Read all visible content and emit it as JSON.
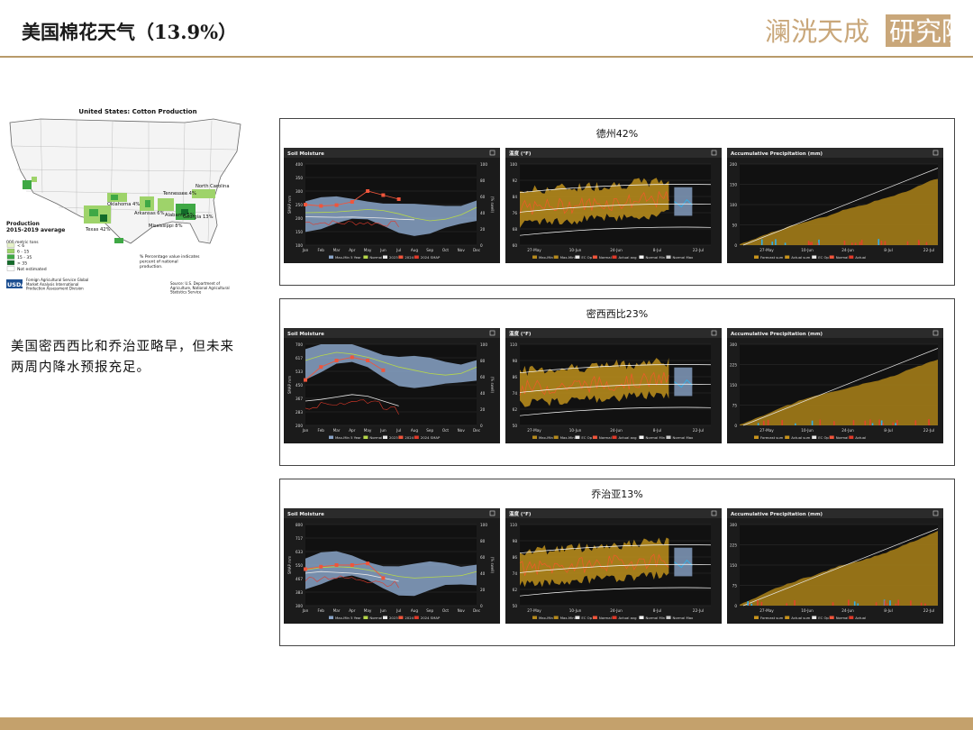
{
  "page": {
    "title": "美国棉花天气（13.9%）",
    "logo_text": "澜洸天成研究院",
    "description": "美国密西西比和乔治亚略早，但未来两周内降水预报充足。"
  },
  "map": {
    "title": "United States: Cotton Production",
    "legend_title": "Production\n2015-2019 average",
    "legend_unit": "000 metric tons",
    "legend_items": [
      "< 6",
      "6 - 15",
      "15 - 35",
      "> 35",
      "Not estimated"
    ],
    "legend_colors": [
      "#e6f2c9",
      "#9ed36a",
      "#3fa845",
      "#136b2a",
      "#ffffff"
    ],
    "labels": [
      "Texas 42%",
      "Oklahoma 4%",
      "Arkansas 6%",
      "Mississippi 8%",
      "Tennessee 4%",
      "Alabama 5%",
      "Georgia 13%",
      "North Carolina"
    ],
    "note": "% Percentage value indicates percent of national production.",
    "usda": "USDA",
    "source_left": "Foreign Agricultural Service Global Market Analysis International Production Assessment Division",
    "source_right": "Source: U.S. Department of Agriculture, National Agricultural Statistics Service"
  },
  "panels": [
    {
      "title": "德州42%"
    },
    {
      "title": "密西西比23%"
    },
    {
      "title": "乔治亚13%"
    }
  ],
  "chart_data": [
    {
      "type": "line",
      "region": "德州42%",
      "title": "Soil Moisture",
      "x": [
        "Jan",
        "Feb",
        "Mar",
        "Apr",
        "May",
        "Jun",
        "Jul",
        "Aug",
        "Sep",
        "Oct",
        "Nov",
        "Dec"
      ],
      "ylabel": "SMAP mm",
      "ylim": [
        100,
        400
      ],
      "y2label": "(% swell)",
      "y2lim": [
        0,
        100
      ],
      "series": [
        {
          "name": "Normal",
          "values": [
            220,
            221,
            223,
            227,
            232,
            228,
            216,
            200,
            190,
            196,
            212,
            240
          ]
        },
        {
          "name": "2023",
          "values": [
            205,
            204,
            203,
            204,
            202,
            200,
            196,
            194,
            null,
            null,
            null,
            null
          ]
        },
        {
          "name": "2024",
          "values": [
            250,
            245,
            248,
            260,
            300,
            285,
            270,
            null,
            null,
            null,
            null,
            null
          ]
        }
      ],
      "legend": [
        "Max-Min 5 Year",
        "Normal",
        "2023",
        "2024",
        "2024 SMAP"
      ]
    },
    {
      "type": "area",
      "region": "德州42%",
      "title": "温度 (°F)",
      "x": [
        "27-May",
        "10-Jun",
        "24-Jun",
        "8-Jul",
        "22-Jul"
      ],
      "ylim": [
        60,
        100
      ],
      "legend": [
        "Max-Min",
        "Max-Min",
        "EC Op",
        "Normal",
        "Actual avg",
        "Normal Min",
        "Normal Max"
      ]
    },
    {
      "type": "area",
      "region": "德州42%",
      "title": "Accumulative Precipitation (mm)",
      "x": [
        "27-May",
        "10-Jun",
        "24-Jun",
        "8-Jul",
        "22-Jul"
      ],
      "ylim": [
        0,
        200
      ],
      "legend": [
        "Forecast sum",
        "Actual sum",
        "EC Op",
        "Normal",
        "Actual"
      ]
    },
    {
      "type": "line",
      "region": "密西西比23%",
      "title": "Soil Moisture",
      "x": [
        "Jan",
        "Feb",
        "Mar",
        "Apr",
        "May",
        "Jun",
        "Jul",
        "Aug",
        "Sep",
        "Oct",
        "Nov",
        "Dec"
      ],
      "ylabel": "SMAP mm",
      "ylim": [
        200,
        700
      ],
      "y2label": "(% swell)",
      "y2lim": [
        0,
        100
      ],
      "series": [
        {
          "name": "Normal",
          "values": [
            600,
            630,
            650,
            640,
            620,
            590,
            560,
            540,
            520,
            510,
            520,
            560
          ]
        },
        {
          "name": "2023",
          "values": [
            350,
            360,
            375,
            390,
            380,
            350,
            320,
            null,
            null,
            null,
            null,
            null
          ]
        },
        {
          "name": "2024",
          "values": [
            480,
            560,
            600,
            620,
            600,
            540,
            null,
            null,
            null,
            null,
            null,
            null
          ]
        }
      ],
      "legend": [
        "Max-Min 5 Year",
        "Normal",
        "2023",
        "2024",
        "2024 SMAP"
      ]
    },
    {
      "type": "area",
      "region": "密西西比23%",
      "title": "温度 (°F)",
      "x": [
        "27-May",
        "10-Jun",
        "24-Jun",
        "8-Jul",
        "22-Jul"
      ],
      "ylim": [
        50,
        110
      ],
      "legend": [
        "Max-Min",
        "Max-Min",
        "EC Op",
        "Normal",
        "Actual avg",
        "Normal Min",
        "Normal Max"
      ]
    },
    {
      "type": "area",
      "region": "密西西比23%",
      "title": "Accumulative Precipitation (mm)",
      "x": [
        "27-May",
        "10-Jun",
        "24-Jun",
        "8-Jul",
        "22-Jul"
      ],
      "ylim": [
        0,
        300
      ],
      "legend": [
        "Forecast sum",
        "Actual sum",
        "EC Op",
        "Normal",
        "Actual"
      ]
    },
    {
      "type": "line",
      "region": "乔治亚13%",
      "title": "Soil Moisture",
      "x": [
        "Jan",
        "Feb",
        "Mar",
        "Apr",
        "May",
        "Jun",
        "Jul",
        "Aug",
        "Sep",
        "Oct",
        "Nov",
        "Dec"
      ],
      "ylabel": "SMAP mm",
      "ylim": [
        300,
        800
      ],
      "y2label": "(% swell)",
      "y2lim": [
        0,
        100
      ],
      "series": [
        {
          "name": "Normal",
          "values": [
            520,
            535,
            540,
            535,
            520,
            500,
            480,
            470,
            475,
            480,
            485,
            510
          ]
        },
        {
          "name": "2023",
          "values": [
            500,
            510,
            505,
            500,
            490,
            470,
            450,
            null,
            null,
            null,
            null,
            null
          ]
        },
        {
          "name": "2024",
          "values": [
            525,
            540,
            550,
            550,
            560,
            470,
            null,
            null,
            null,
            null,
            null,
            null
          ]
        }
      ],
      "legend": [
        "Max-Min 5 Year",
        "Normal",
        "2023",
        "2024",
        "2024 SMAP"
      ]
    },
    {
      "type": "area",
      "region": "乔治亚13%",
      "title": "温度 (°F)",
      "x": [
        "27-May",
        "10-Jun",
        "24-Jun",
        "8-Jul",
        "22-Jul"
      ],
      "ylim": [
        50,
        110
      ],
      "legend": [
        "Max-Min",
        "Max-Min",
        "EC Op",
        "Normal",
        "Actual avg",
        "Normal Min",
        "Normal Max"
      ]
    },
    {
      "type": "area",
      "region": "乔治亚13%",
      "title": "Accumulative Precipitation (mm)",
      "x": [
        "27-May",
        "10-Jun",
        "24-Jun",
        "8-Jul",
        "22-Jul"
      ],
      "ylim": [
        0,
        300
      ],
      "legend": [
        "Forecast sum",
        "Actual sum",
        "EC Op",
        "Normal",
        "Actual"
      ]
    }
  ]
}
